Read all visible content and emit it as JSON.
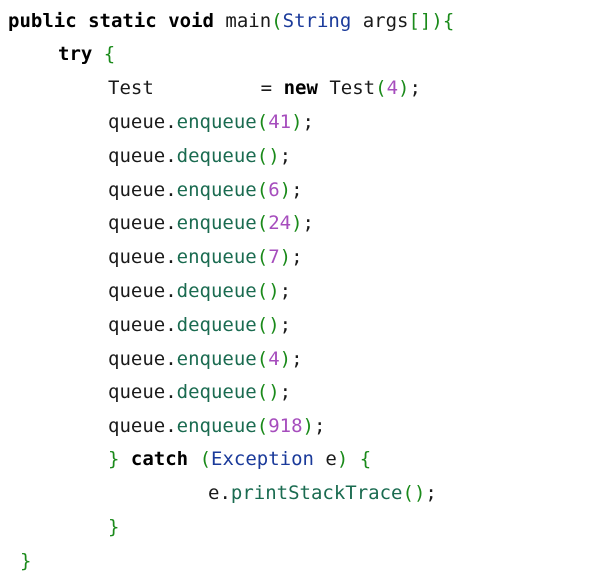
{
  "code": {
    "line1": {
      "kw1": "public",
      "kw2": "static",
      "kw3": "void",
      "name": "main",
      "open": "(",
      "type": "String",
      "arg": "args",
      "brackets": "[]",
      "close": ")",
      "brace": "{"
    },
    "line2": {
      "kw": "try",
      "brace": "{"
    },
    "line3": {
      "type": "Test",
      "eq": "=",
      "kw": "new",
      "ctor": "Test",
      "open": "(",
      "arg": "4",
      "close": ")",
      "semi": ";"
    },
    "calls": [
      {
        "obj": "queue",
        "method": "enqueue",
        "arg": "41"
      },
      {
        "obj": "queue",
        "method": "dequeue",
        "arg": ""
      },
      {
        "obj": "queue",
        "method": "enqueue",
        "arg": "6"
      },
      {
        "obj": "queue",
        "method": "enqueue",
        "arg": "24"
      },
      {
        "obj": "queue",
        "method": "enqueue",
        "arg": "7"
      },
      {
        "obj": "queue",
        "method": "dequeue",
        "arg": ""
      },
      {
        "obj": "queue",
        "method": "dequeue",
        "arg": ""
      },
      {
        "obj": "queue",
        "method": "enqueue",
        "arg": "4"
      },
      {
        "obj": "queue",
        "method": "dequeue",
        "arg": ""
      },
      {
        "obj": "queue",
        "method": "enqueue",
        "arg": "918"
      }
    ],
    "catch_line": {
      "brace_close": "}",
      "kw": "catch",
      "open": "(",
      "type": "Exception",
      "var": "e",
      "close": ")",
      "brace_open": "{"
    },
    "print_line": {
      "obj": "e",
      "method": "printStackTrace",
      "parens": "()",
      "semi": ";"
    },
    "try_close": "}",
    "main_close": "}"
  }
}
